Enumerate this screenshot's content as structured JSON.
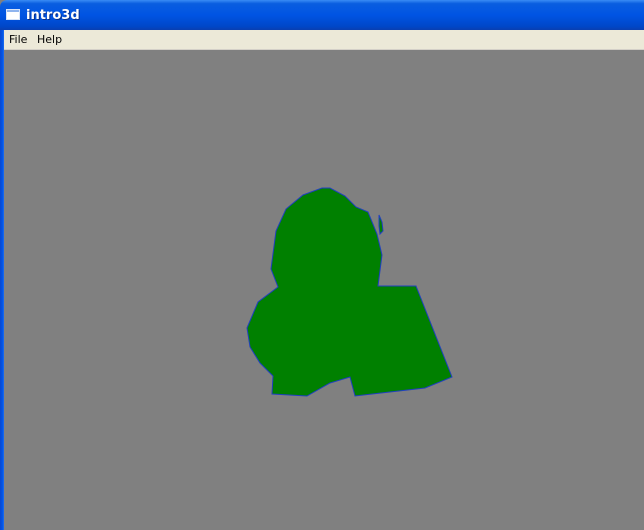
{
  "window": {
    "title": "intro3d",
    "icon": "app-window-icon"
  },
  "menubar": {
    "items": [
      {
        "label": "File"
      },
      {
        "label": "Help"
      }
    ]
  },
  "viewport": {
    "background": "#808080",
    "model_fill": "#008000",
    "model_outline": "#1f3fbf"
  }
}
